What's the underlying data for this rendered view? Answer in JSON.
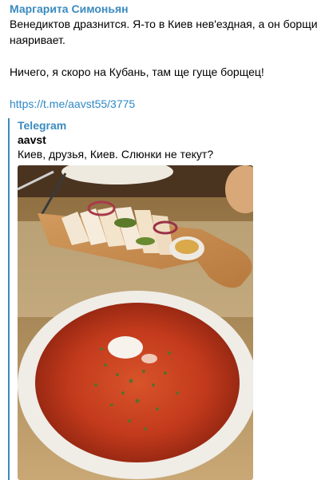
{
  "message": {
    "author": "Маргарита Симоньян",
    "lines": [
      "Венедиктов дразнится. Я-то в Киев нев'ездная, а он борщи",
      "наяривает.",
      "Ничего, я скоро на Кубань, там ще гуще борщец!"
    ],
    "link": "https://t.me/aavst55/3775"
  },
  "preview": {
    "site": "Telegram",
    "title": "aavst",
    "description": "Киев, друзья, Киев. Слюнки не текут?"
  },
  "colors": {
    "accent": "#3a8ac0",
    "link": "#2f88c5"
  }
}
